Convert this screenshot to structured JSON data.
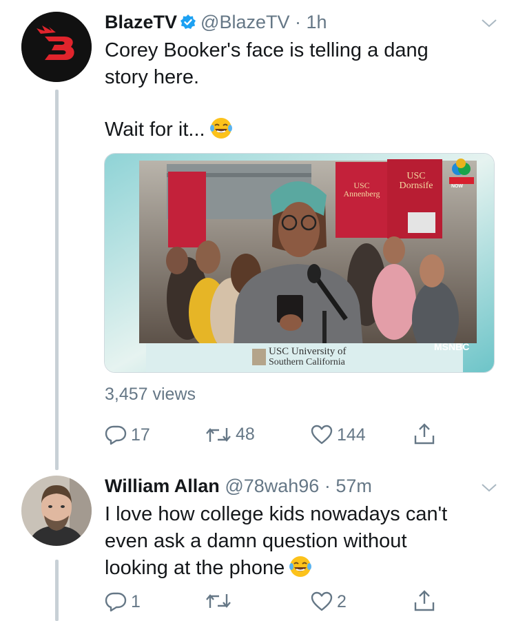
{
  "tweet1": {
    "display_name": "BlazeTV",
    "handle": "@BlazeTV",
    "time": "1h",
    "text_line1": "Corey Booker's face is telling a dang",
    "text_line2": "story here.",
    "text_line3": "Wait for it...",
    "views": "3,457 views",
    "reply_count": "17",
    "retweet_count": "48",
    "like_count": "144",
    "video": {
      "banner1_title": "USC",
      "banner1_sub": "Annenberg",
      "banner2_title": "USC",
      "banner2_sub": "Dornsife",
      "caption_line1": "USC University of",
      "caption_line2": "Southern California",
      "network": "MSNBC",
      "live_badge": "NOW"
    }
  },
  "tweet2": {
    "display_name": "William Allan",
    "handle": "@78wah96",
    "time": "57m",
    "text_line1": "I love how college kids nowadays can't",
    "text_line2": "even ask a damn question without",
    "text_line3": "looking at the phone",
    "reply_count": "1",
    "retweet_count": "",
    "like_count": "2"
  },
  "colors": {
    "accent": "#1da1f2",
    "muted": "#657786",
    "thread": "#c8d0d6",
    "blaze_red": "#e0242c"
  },
  "icons": {
    "verified": "verified-badge-icon",
    "caret": "chevron-down-icon",
    "reply": "reply-icon",
    "retweet": "retweet-icon",
    "like": "heart-icon",
    "share": "share-icon",
    "emoji": "tears-of-joy-emoji"
  }
}
